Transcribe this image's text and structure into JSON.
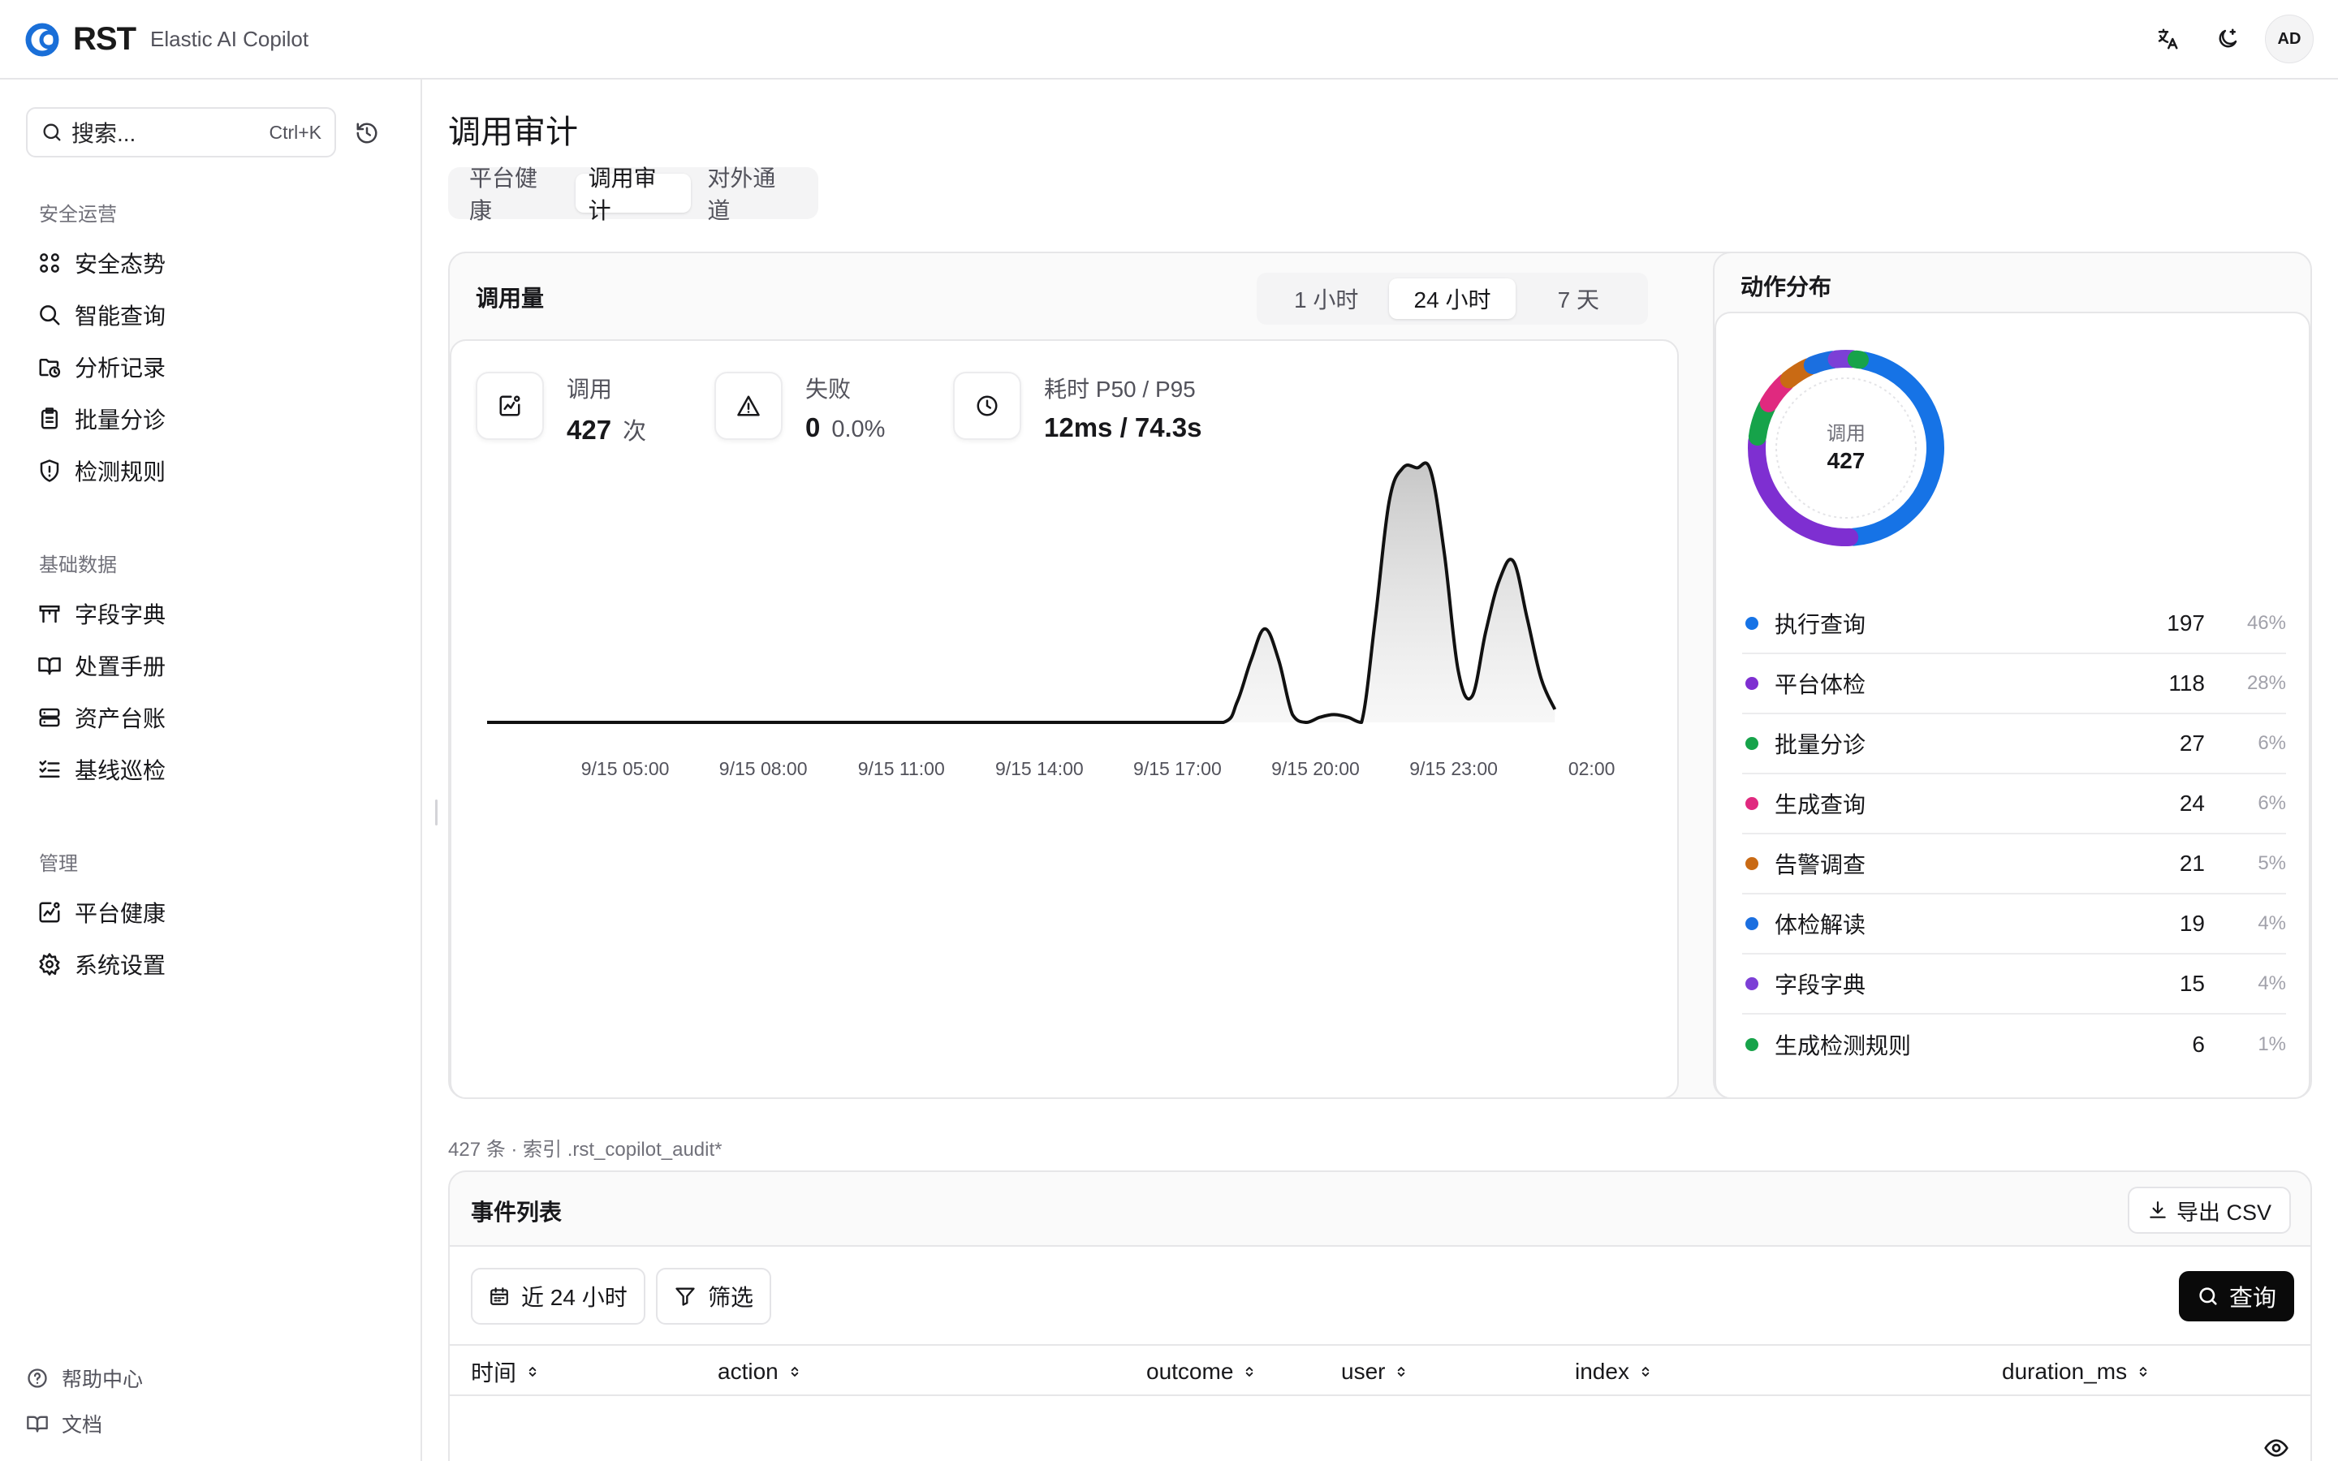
{
  "header": {
    "logo_text": "RST",
    "app_name": "Elastic AI Copilot",
    "avatar_initials": "AD",
    "icons": [
      "translate-icon",
      "theme-toggle-icon"
    ]
  },
  "sidebar": {
    "search_placeholder": "搜索...",
    "search_shortcut": "Ctrl+K",
    "sections": [
      {
        "title": "安全运营",
        "items": [
          {
            "label": "安全态势",
            "icon": "grid-icon"
          },
          {
            "label": "智能查询",
            "icon": "search-icon"
          },
          {
            "label": "分析记录",
            "icon": "history-folder-icon"
          },
          {
            "label": "批量分诊",
            "icon": "clipboard-icon"
          },
          {
            "label": "检测规则",
            "icon": "shield-alert-icon"
          }
        ]
      },
      {
        "title": "基础数据",
        "items": [
          {
            "label": "字段字典",
            "icon": "table-icon"
          },
          {
            "label": "处置手册",
            "icon": "book-icon"
          },
          {
            "label": "资产台账",
            "icon": "server-icon"
          },
          {
            "label": "基线巡检",
            "icon": "checklist-icon"
          }
        ]
      },
      {
        "title": "管理",
        "items": [
          {
            "label": "平台健康",
            "icon": "health-chart-icon"
          },
          {
            "label": "系统设置",
            "icon": "gear-icon"
          }
        ]
      }
    ],
    "footer": [
      {
        "label": "帮助中心",
        "icon": "help-icon"
      },
      {
        "label": "文档",
        "icon": "book-open-icon"
      }
    ]
  },
  "main": {
    "title": "调用审计",
    "tabs": [
      {
        "label": "平台健康",
        "active": false
      },
      {
        "label": "调用审计",
        "active": true
      },
      {
        "label": "对外通道",
        "active": false
      }
    ]
  },
  "volume_card": {
    "title": "调用量",
    "ranges": [
      {
        "label": "1 小时",
        "active": false
      },
      {
        "label": "24 小时",
        "active": true
      },
      {
        "label": "7 天",
        "active": false
      }
    ],
    "stats": [
      {
        "label": "调用",
        "value": "427",
        "unit": "次",
        "icon": "chart-icon"
      },
      {
        "label": "失败",
        "value": "0",
        "unit": "0.0%",
        "icon": "warning-icon"
      },
      {
        "label": "耗时 P50 / P95",
        "value": "12ms / 74.3s",
        "unit": "",
        "icon": "clock-icon"
      }
    ]
  },
  "chart_data": {
    "type": "area",
    "x_ticks": [
      "9/15 05:00",
      "9/15 08:00",
      "9/15 11:00",
      "9/15 14:00",
      "9/15 17:00",
      "9/15 20:00",
      "9/15 23:00",
      "02:00"
    ],
    "x_tick_hours": [
      5,
      8,
      11,
      14,
      17,
      20,
      23,
      26
    ],
    "x_range_hours": [
      2.0,
      27.4
    ],
    "x": [
      2.0,
      4,
      6,
      8,
      10,
      12,
      14,
      15,
      16,
      17,
      18.0,
      18.3,
      18.6,
      18.9,
      19.2,
      19.5,
      19.8,
      20.1,
      20.4,
      20.7,
      21.0,
      21.3,
      21.6,
      21.9,
      22.2,
      22.5,
      22.8,
      23.1,
      23.4,
      23.7,
      24.0,
      24.3,
      24.6,
      24.9,
      25.2,
      25.5,
      25.8,
      26.1,
      26.4,
      26.7,
      27.0,
      27.3
    ],
    "values": [
      0,
      0,
      0,
      0,
      0,
      0,
      0,
      0,
      0,
      0,
      0,
      8,
      24,
      36,
      24,
      3,
      0,
      2,
      3,
      2,
      0,
      40,
      85,
      98,
      98,
      97,
      65,
      20,
      10,
      35,
      55,
      62,
      40,
      17,
      5
    ],
    "ylim": [
      0,
      100
    ],
    "grid": false,
    "series": [
      {
        "name": "调用",
        "color": "#111111"
      }
    ]
  },
  "distribution_card": {
    "title": "动作分布",
    "center_label": "调用",
    "center_value": "427",
    "items": [
      {
        "name": "执行查询",
        "count": "197",
        "pct": "46%",
        "value": 197,
        "color": "#1673e6"
      },
      {
        "name": "平台体检",
        "count": "118",
        "pct": "28%",
        "value": 118,
        "color": "#7e2fd1"
      },
      {
        "name": "批量分诊",
        "count": "27",
        "pct": "6%",
        "value": 27,
        "color": "#16a34a"
      },
      {
        "name": "生成查询",
        "count": "24",
        "pct": "6%",
        "value": 24,
        "color": "#e0297f"
      },
      {
        "name": "告警调查",
        "count": "21",
        "pct": "5%",
        "value": 21,
        "color": "#c96a14"
      },
      {
        "name": "体检解读",
        "count": "19",
        "pct": "4%",
        "value": 19,
        "color": "#1b6fe0"
      },
      {
        "name": "字段字典",
        "count": "15",
        "pct": "4%",
        "value": 15,
        "color": "#7c3fd6"
      },
      {
        "name": "生成检测规则",
        "count": "6",
        "pct": "1%",
        "value": 6,
        "color": "#17a34a"
      }
    ]
  },
  "events": {
    "meta": "427 条 · 索引 .rst_copilot_audit*",
    "title": "事件列表",
    "export_label": "导出 CSV",
    "time_filter_label": "近 24 小时",
    "filter_label": "筛选",
    "query_label": "查询",
    "columns": [
      "时间",
      "action",
      "outcome",
      "user",
      "index",
      "duration_ms"
    ]
  }
}
